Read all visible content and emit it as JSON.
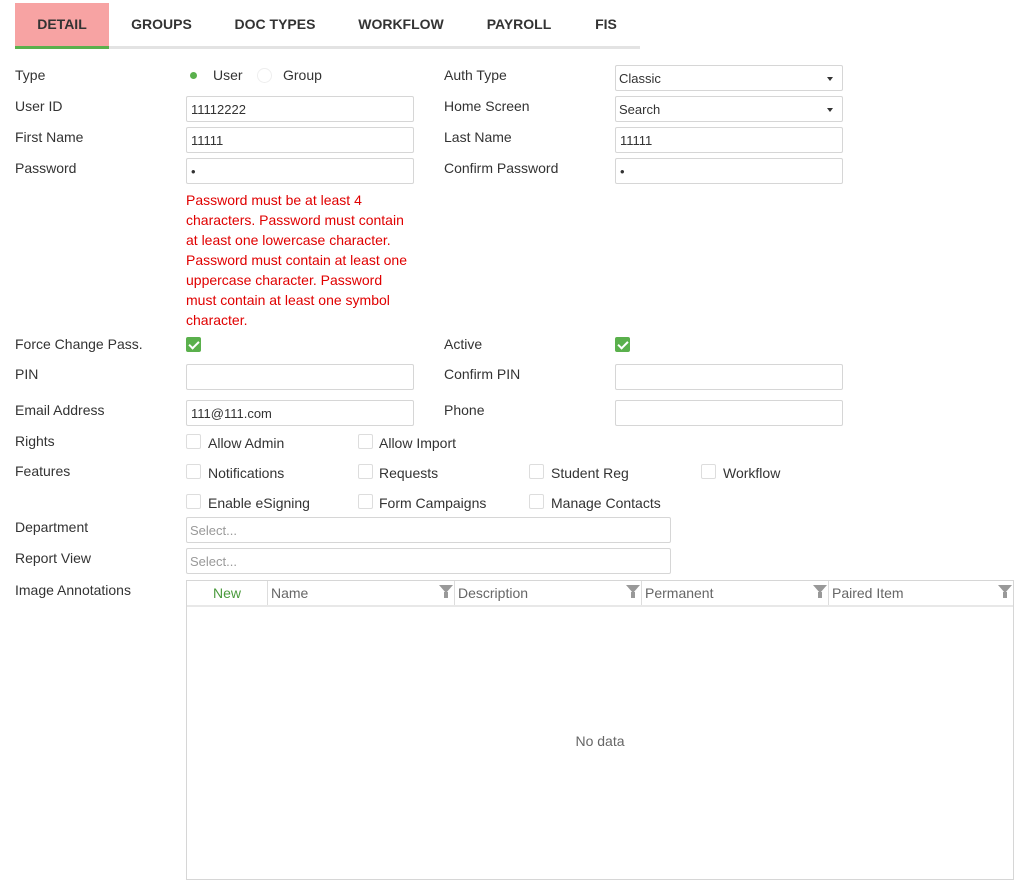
{
  "tabs": [
    "DETAIL",
    "GROUPS",
    "DOC TYPES",
    "WORKFLOW",
    "PAYROLL",
    "FIS"
  ],
  "active_tab": "DETAIL",
  "labels": {
    "type": "Type",
    "user_id": "User ID",
    "first_name": "First Name",
    "password": "Password",
    "force_change": "Force Change Pass.",
    "pin": "PIN",
    "email": "Email Address",
    "rights": "Rights",
    "features": "Features",
    "department": "Department",
    "report_view": "Report View",
    "image_annotations": "Image Annotations",
    "auth_type": "Auth Type",
    "home_screen": "Home Screen",
    "last_name": "Last Name",
    "confirm_password": "Confirm Password",
    "active": "Active",
    "confirm_pin": "Confirm PIN",
    "phone": "Phone"
  },
  "type_options": [
    {
      "label": "User",
      "checked": true
    },
    {
      "label": "Group",
      "checked": false
    }
  ],
  "fields": {
    "user_id": "11112222",
    "first_name": "11111",
    "password": "•",
    "pin": "",
    "email": "111@111.com",
    "last_name": "11111",
    "confirm_password": "•",
    "confirm_pin": "",
    "phone": ""
  },
  "selects": {
    "auth_type": "Classic",
    "home_screen": "Search",
    "department_placeholder": "Select...",
    "report_view_placeholder": "Select..."
  },
  "password_error": "Password must be at least 4 characters. Password must contain at least one lowercase character. Password must contain at least one uppercase character. Password must contain at least one symbol character.",
  "force_change_checked": true,
  "active_checked": true,
  "rights": [
    {
      "label": "Allow Admin",
      "checked": false
    },
    {
      "label": "Allow Import",
      "checked": false
    }
  ],
  "features": [
    {
      "label": "Notifications",
      "checked": false
    },
    {
      "label": "Requests",
      "checked": false
    },
    {
      "label": "Student Reg",
      "checked": false
    },
    {
      "label": "Workflow",
      "checked": false
    },
    {
      "label": "Enable eSigning",
      "checked": false
    },
    {
      "label": "Form Campaigns",
      "checked": false
    },
    {
      "label": "Manage Contacts",
      "checked": false
    }
  ],
  "grid": {
    "new_label": "New",
    "columns": [
      "Name",
      "Description",
      "Permanent",
      "Paired Item"
    ],
    "empty_text": "No data"
  },
  "colors": {
    "accent": "#5ab04c",
    "active_tab_bg": "#f7a3a3",
    "error": "#e00000"
  }
}
